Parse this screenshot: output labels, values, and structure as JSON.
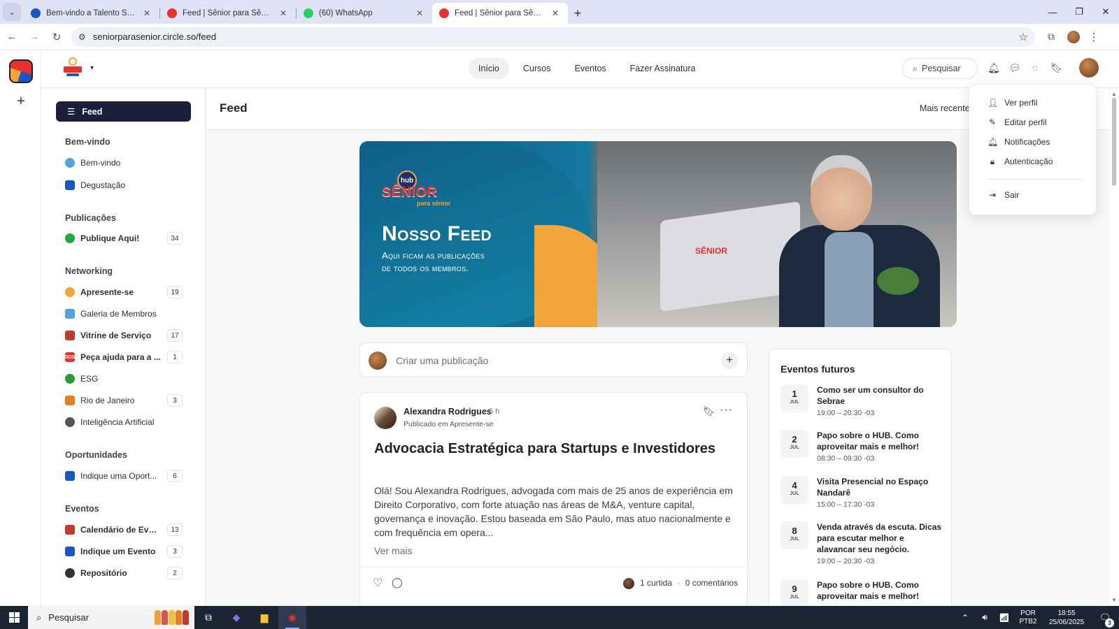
{
  "browser": {
    "tabs": [
      {
        "title": "Bem-vindo a Talento Senior | Ta",
        "favicon_color": "#1a57c4",
        "active": false
      },
      {
        "title": "Feed | Sênior para Sênior",
        "favicon_color": "#e8312f",
        "active": false
      },
      {
        "title": "(60) WhatsApp",
        "favicon_color": "#25d366",
        "active": false
      },
      {
        "title": "Feed | Sênior para Sênior",
        "favicon_color": "#e8312f",
        "active": true
      }
    ],
    "new_tab": "+",
    "url": "seniorparasenior.circle.so/feed"
  },
  "header": {
    "nav": [
      {
        "label": "Início",
        "active": true
      },
      {
        "label": "Cursos",
        "active": false
      },
      {
        "label": "Eventos",
        "active": false
      },
      {
        "label": "Fazer Assinatura",
        "active": false
      }
    ],
    "search_label": "Pesquisar",
    "icons": [
      "bell-icon",
      "chat-icon",
      "messages-icon",
      "bookmark-icon"
    ]
  },
  "sidebar": {
    "feed_label": "Feed",
    "sections": [
      {
        "title": "Bem-vindo",
        "items": [
          {
            "label": "Bem-vindo",
            "count": "",
            "icon_color": "#4fa3e0"
          },
          {
            "label": "Degustação",
            "count": "",
            "icon_color": "#1a57c4"
          }
        ]
      },
      {
        "title": "Publicações",
        "items": [
          {
            "label": "Publique Aqui!",
            "count": "34",
            "icon_color": "#22a83a"
          }
        ]
      },
      {
        "title": "Networking",
        "items": [
          {
            "label": "Apresente-se",
            "count": "19",
            "icon_color": "#f2a53b"
          },
          {
            "label": "Galeria de Membros",
            "count": "",
            "icon_color": "#4fa3e0"
          },
          {
            "label": "Vitrine de Serviço",
            "count": "17",
            "icon_color": "#c0392b"
          },
          {
            "label": "Peça ajuda para a ...",
            "count": "1",
            "icon_color": "#e8312f"
          },
          {
            "label": "ESG",
            "count": "",
            "icon_color": "#2e9b3b"
          },
          {
            "label": "Rio de Janeiro",
            "count": "3",
            "icon_color": "#e67e22"
          },
          {
            "label": "Inteligência Artificial",
            "count": "",
            "icon_color": "#555555"
          }
        ]
      },
      {
        "title": "Oportunidades",
        "items": [
          {
            "label": "Indique uma Oport...",
            "count": "6",
            "icon_color": "#1a57c4"
          }
        ]
      },
      {
        "title": "Eventos",
        "items": [
          {
            "label": "Calendário de Even...",
            "count": "13",
            "icon_color": "#c0392b"
          },
          {
            "label": "Indique um Evento",
            "count": "3",
            "icon_color": "#1a57c4"
          },
          {
            "label": "Repositório",
            "count": "2",
            "icon_color": "#333333"
          }
        ]
      }
    ]
  },
  "feed": {
    "title": "Feed",
    "sort": "Mais recente",
    "banner": {
      "logo_hub": "hub",
      "logo_text": "SÊNIOR",
      "logo_sub": "para sênior",
      "title": "Nosso Feed",
      "subtitle_1": "Aqui ficam as publicações",
      "subtitle_2": "de todos os membros.",
      "laptop_logo": "SÊNIOR"
    },
    "composer_placeholder": "Criar uma publicação",
    "post": {
      "author": "Alexandra Rodrigues",
      "time": "5 h",
      "space": "Publicado em Apresente-se",
      "title": "Advocacia Estratégica para Startups e Investidores",
      "body": "Olá! Sou Alexandra Rodrigues, advogada com mais de 25 anos de experiência em Direito Corporativo, com forte atuação nas áreas de M&A, venture capital, governança e inovação. Estou baseada em São Paulo, mas atuo nacionalmente e com frequência em opera...",
      "see_more": "Ver mais",
      "likes": "1 curtida",
      "separator": "·",
      "comments": "0 comentários"
    }
  },
  "events": {
    "title": "Eventos futuros",
    "items": [
      {
        "day": "1",
        "month": "JUL",
        "name": "Como ser um consultor do Sebrae",
        "time": "19:00 – 20:30 -03"
      },
      {
        "day": "2",
        "month": "JUL",
        "name": "Papo sobre o HUB. Como aproveitar mais e melhor!",
        "time": "08:30 – 09:30 -03"
      },
      {
        "day": "4",
        "month": "JUL",
        "name": "Visita Presencial no Espaço Nandarê",
        "time": "15:00 – 17:30 -03"
      },
      {
        "day": "8",
        "month": "JUL",
        "name": "Venda através da escuta. Dicas para escutar melhor e alavancar seu negócio.",
        "time": "19:00 – 20:30 -03"
      },
      {
        "day": "9",
        "month": "JUL",
        "name": "Papo sobre o HUB. Como aproveitar mais e melhor!",
        "time": ""
      }
    ]
  },
  "profile_menu": {
    "items": [
      {
        "label": "Ver perfil",
        "icon": "user-icon"
      },
      {
        "label": "Editar perfil",
        "icon": "pencil-icon"
      },
      {
        "label": "Notificações",
        "icon": "bell-icon"
      },
      {
        "label": "Autenticação",
        "icon": "lock-icon"
      }
    ],
    "logout": "Sair"
  },
  "taskbar": {
    "search": "Pesquisar",
    "lang_1": "POR",
    "lang_2": "PTB2",
    "time": "18:55",
    "date": "25/06/2025",
    "notifications": "3"
  }
}
